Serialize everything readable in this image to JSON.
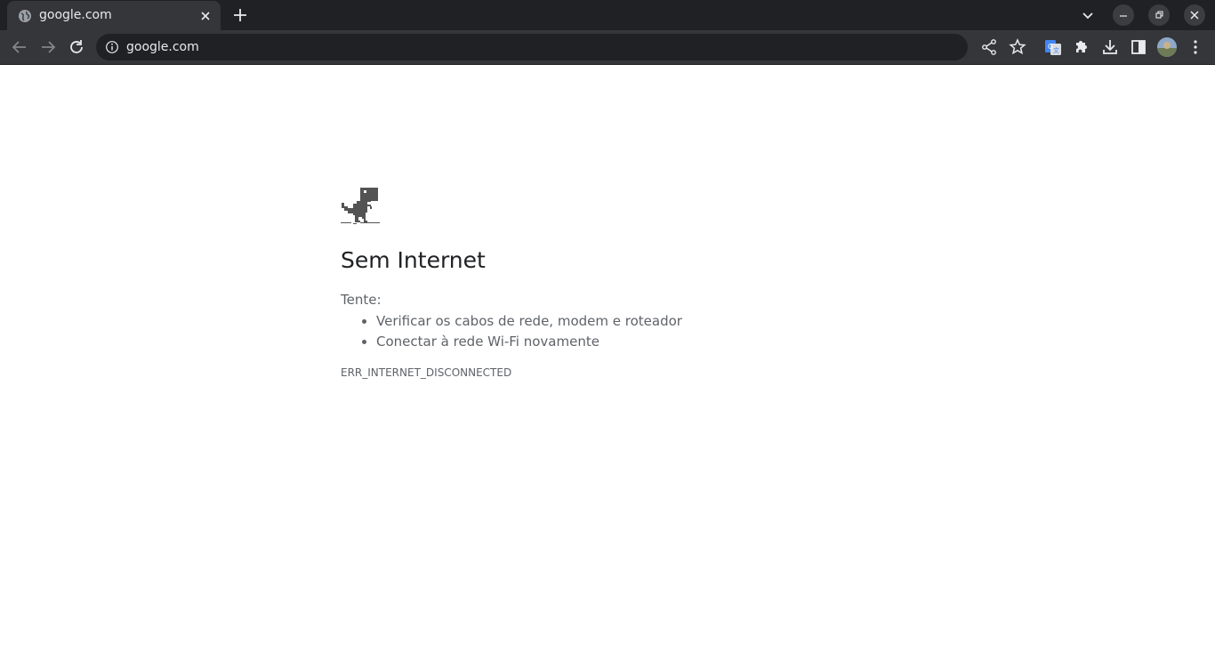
{
  "browser": {
    "tab": {
      "title": "google.com"
    },
    "address_bar": {
      "url": "google.com"
    },
    "icons": [
      "globe-icon",
      "close-icon",
      "plus-icon",
      "chevron-down-icon",
      "minimize-icon",
      "restore-icon",
      "close-window-icon",
      "back-icon",
      "forward-icon",
      "reload-icon",
      "info-icon",
      "share-icon",
      "star-icon",
      "translate-icon",
      "puzzle-icon",
      "download-icon",
      "sidepanel-icon",
      "avatar",
      "menu-icon"
    ]
  },
  "error_page": {
    "heading": "Sem Internet",
    "try_label": "Tente:",
    "suggestions": [
      "Verificar os cabos de rede, modem e roteador",
      "Conectar à rede Wi-Fi novamente"
    ],
    "error_code": "ERR_INTERNET_DISCONNECTED"
  },
  "colors": {
    "titlebar_bg": "#202124",
    "toolbar_bg": "#35363a",
    "text_primary": "#202124",
    "text_secondary": "#5f6368"
  }
}
